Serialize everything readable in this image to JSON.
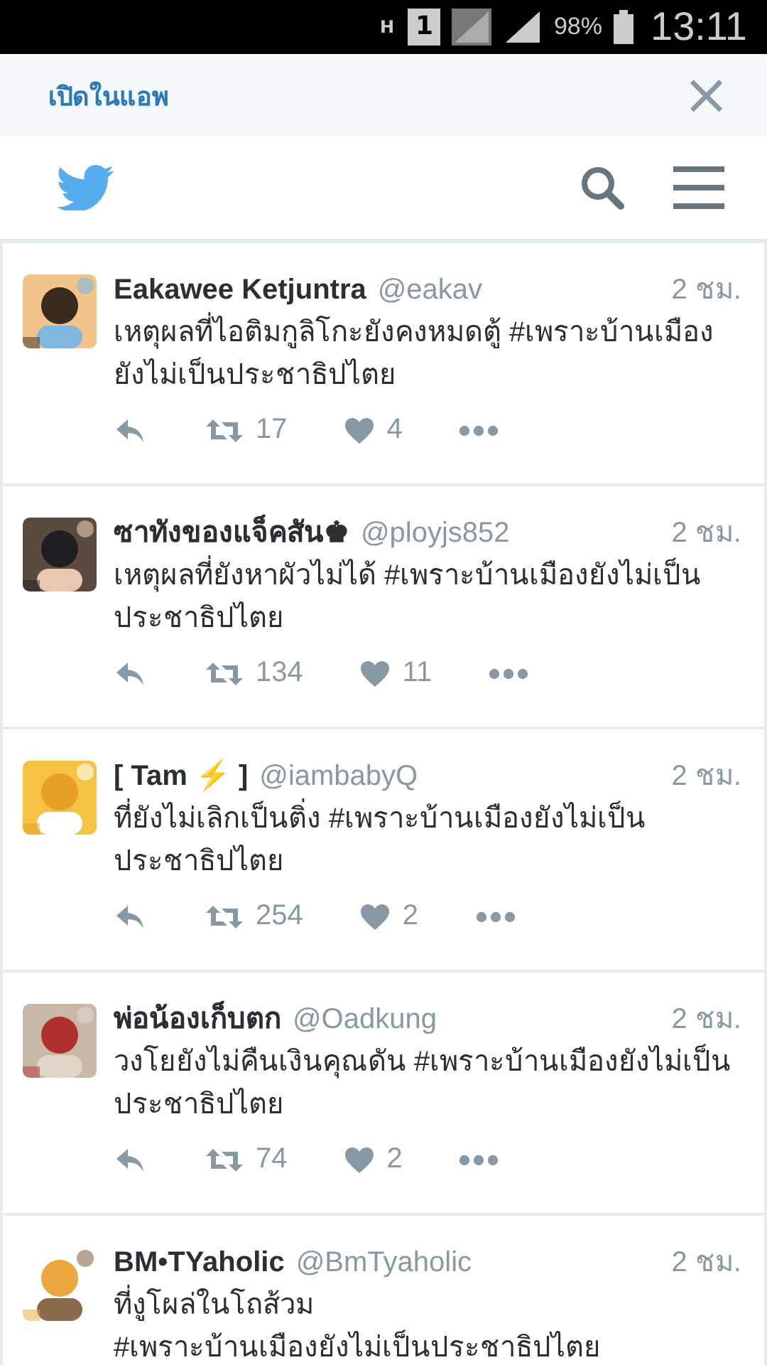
{
  "status_bar": {
    "network": "H",
    "sim": "1",
    "battery": "98%",
    "time": "13:11"
  },
  "banner": {
    "open_in_app": "เปิดในแอพ",
    "close": "×"
  },
  "tweets": [
    {
      "name": "Eakawee Ketjuntra",
      "handle": "@eakav",
      "time": "2 ชม.",
      "text": "เหตุผลที่ไอติมกูลิโกะยังคงหมดตู้ #เพราะบ้านเมืองยังไม่เป็นประชาธิปไตย",
      "retweets": "17",
      "likes": "4"
    },
    {
      "name": "ซาทังของแจ็คสัน♚",
      "handle": "@ployjs852",
      "time": "2 ชม.",
      "text": "เหตุผลที่ยังหาผัวไม่ได้ #เพราะบ้านเมืองยังไม่เป็นประชาธิปไตย",
      "retweets": "134",
      "likes": "11"
    },
    {
      "name": "[ Tam ⚡ ]",
      "handle": "@iambabyQ",
      "time": "2 ชม.",
      "text": "ที่ยังไม่เลิกเป็นติ่ง #เพราะบ้านเมืองยังไม่เป็นประชาธิปไตย",
      "retweets": "254",
      "likes": "2"
    },
    {
      "name": "พ่อน้องเก็บตก",
      "handle": "@Oadkung",
      "time": "2 ชม.",
      "text": "วงโยยังไม่คืนเงินคุณดัน #เพราะบ้านเมืองยังไม่เป็นประชาธิปไตย",
      "retweets": "74",
      "likes": "2"
    },
    {
      "name": "BM•TYaholic",
      "handle": "@BmTyaholic",
      "time": "2 ชม.",
      "text": "ที่งูโผล่ในโถส้วม\n#เพราะบ้านเมืองยังไม่เป็นประชาธิปไตย"
    }
  ]
}
